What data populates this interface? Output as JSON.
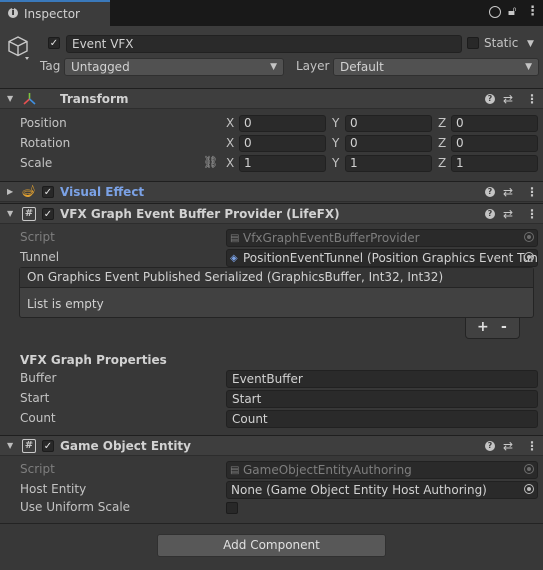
{
  "tab": {
    "label": "Inspector"
  },
  "toolbar": {
    "icons": [
      "lock-icon",
      "debug-circle-icon",
      "more-vert-icon"
    ]
  },
  "gameobject": {
    "active": true,
    "name": "Event VFX",
    "static_label": "Static",
    "static_checked": false,
    "tag_label": "Tag",
    "tag_value": "Untagged",
    "layer_label": "Layer",
    "layer_value": "Default"
  },
  "transform": {
    "title": "Transform",
    "rows": [
      {
        "label": "Position",
        "x": "0",
        "y": "0",
        "z": "0"
      },
      {
        "label": "Rotation",
        "x": "0",
        "y": "0",
        "z": "0"
      },
      {
        "label": "Scale",
        "x": "1",
        "y": "1",
        "z": "1"
      }
    ],
    "axis": {
      "x": "X",
      "y": "Y",
      "z": "Z"
    }
  },
  "visual_effect": {
    "title": "Visual Effect",
    "enabled": true
  },
  "vfx_provider": {
    "title": "VFX Graph Event Buffer Provider (LifeFX)",
    "enabled": true,
    "script_label": "Script",
    "script_value": "VfxGraphEventBufferProvider",
    "tunnel_label": "Tunnel",
    "tunnel_value": "PositionEventTunnel (Position Graphics Event Tunnel)",
    "event_header": "On Graphics Event Published Serialized (GraphicsBuffer, Int32, Int32)",
    "event_empty": "List is empty",
    "plus": "+",
    "minus": "-",
    "section_title": "VFX Graph Properties",
    "props": [
      {
        "label": "Buffer",
        "value": "EventBuffer"
      },
      {
        "label": "Start",
        "value": "Start"
      },
      {
        "label": "Count",
        "value": "Count"
      }
    ]
  },
  "entity": {
    "title": "Game Object Entity",
    "enabled": true,
    "script_label": "Script",
    "script_value": "GameObjectEntityAuthoring",
    "host_label": "Host Entity",
    "host_value": "None (Game Object Entity Host Authoring)",
    "uniform_label": "Use Uniform Scale",
    "uniform_checked": false
  },
  "add_component": "Add Component",
  "colors": {
    "accent": "#3a79bb",
    "link_title": "#7ba2e6",
    "background": "#383838"
  }
}
